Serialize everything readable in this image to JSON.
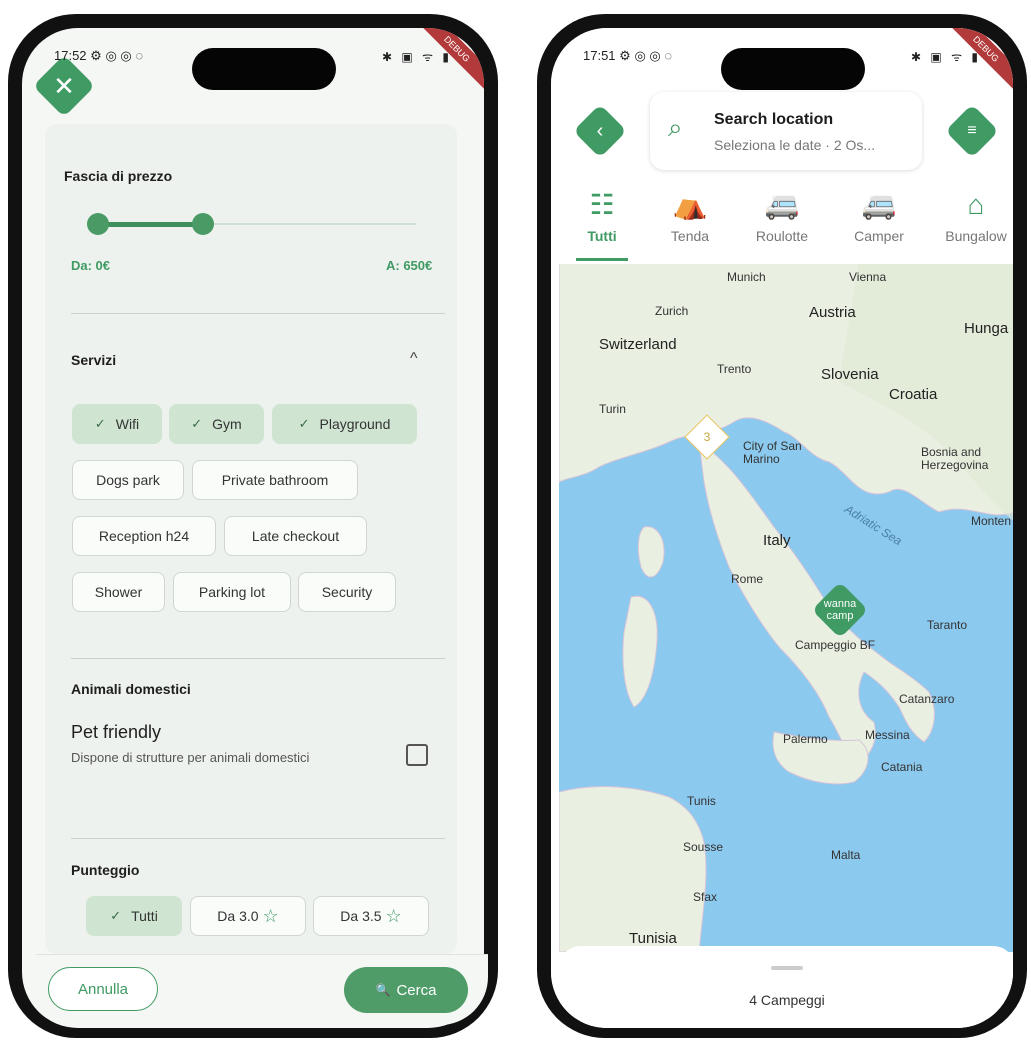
{
  "left_phone": {
    "status": {
      "time": "17:52",
      "icons": "⚙ ◎ ◎ ◌",
      "right_icons": "✱ ▣ ᯤ ▮"
    },
    "debug_banner": "DEBUG",
    "price": {
      "title": "Fascia di prezzo",
      "from_label": "Da: 0€",
      "to_label": "A: 650€",
      "range_fraction": [
        0,
        0.33
      ]
    },
    "services": {
      "title": "Servizi",
      "collapse_icon": "^",
      "chips": [
        {
          "label": "Wifi",
          "selected": true
        },
        {
          "label": "Gym",
          "selected": true
        },
        {
          "label": "Playground",
          "selected": true
        },
        {
          "label": "Dogs park",
          "selected": false
        },
        {
          "label": "Private bathroom",
          "selected": false
        },
        {
          "label": "Reception h24",
          "selected": false
        },
        {
          "label": "Late checkout",
          "selected": false
        },
        {
          "label": "Shower",
          "selected": false
        },
        {
          "label": "Parking lot",
          "selected": false
        },
        {
          "label": "Security",
          "selected": false
        }
      ]
    },
    "pets": {
      "title": "Animali domestici",
      "option_title": "Pet friendly",
      "option_desc": "Dispone di strutture per animali domestici",
      "checked": false
    },
    "score": {
      "title": "Punteggio",
      "chips": [
        {
          "label": "Tutti",
          "selected": true
        },
        {
          "label": "Da 3.0",
          "selected": false,
          "star": "☆"
        },
        {
          "label": "Da 3.5",
          "selected": false,
          "star": "☆"
        }
      ]
    },
    "actions": {
      "cancel": "Annulla",
      "search": "Cerca",
      "search_icon": "🔍"
    }
  },
  "right_phone": {
    "status": {
      "time": "17:51",
      "icons": "⚙ ◎ ◎ ◌",
      "right_icons": "✱ ▣ ᯤ ▮"
    },
    "debug_banner": "DEBUG",
    "search": {
      "title": "Search location",
      "subtitle": "Seleziona le date · 2 Os..."
    },
    "categories": [
      {
        "label": "Tutti",
        "icon": "☷",
        "active": true
      },
      {
        "label": "Tenda",
        "icon": "⛺",
        "active": false
      },
      {
        "label": "Roulotte",
        "icon": "🚐",
        "active": false
      },
      {
        "label": "Camper",
        "icon": "🚐",
        "active": false
      },
      {
        "label": "Bungalow",
        "icon": "⌂",
        "active": false
      }
    ],
    "map_labels": [
      {
        "text": "Munich"
      },
      {
        "text": "Vienna"
      },
      {
        "text": "Zurich"
      },
      {
        "text": "Austria"
      },
      {
        "text": "Switzerland"
      },
      {
        "text": "Hunga"
      },
      {
        "text": "Trento"
      },
      {
        "text": "Slovenia"
      },
      {
        "text": "Croatia"
      },
      {
        "text": "Turin"
      },
      {
        "text": "City of San Marino"
      },
      {
        "text": "Bosnia and Herzegovina"
      },
      {
        "text": "Adriatic Sea"
      },
      {
        "text": "Monten"
      },
      {
        "text": "Italy"
      },
      {
        "text": "Rome"
      },
      {
        "text": "Campeggio BF"
      },
      {
        "text": "Taranto"
      },
      {
        "text": "Catanzaro"
      },
      {
        "text": "Palermo"
      },
      {
        "text": "Messina"
      },
      {
        "text": "Catania"
      },
      {
        "text": "Tunis"
      },
      {
        "text": "Sousse"
      },
      {
        "text": "Malta"
      },
      {
        "text": "Sfax"
      },
      {
        "text": "Tunisia"
      }
    ],
    "cluster_count": "3",
    "pin_label": "wanna camp",
    "sheet_count": "4 Campeggi"
  },
  "colors": {
    "accent": "#3f9a63",
    "chip_selected": "#cfe5d2",
    "sea": "#8cc9ee",
    "land": "#e9efe1"
  }
}
